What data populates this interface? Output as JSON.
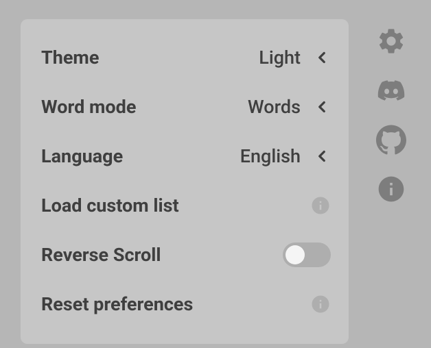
{
  "settings": {
    "theme": {
      "label": "Theme",
      "value": "Light"
    },
    "wordMode": {
      "label": "Word mode",
      "value": "Words"
    },
    "language": {
      "label": "Language",
      "value": "English"
    },
    "loadCustomList": {
      "label": "Load custom list"
    },
    "reverseScroll": {
      "label": "Reverse Scroll",
      "enabled": false
    },
    "resetPreferences": {
      "label": "Reset preferences"
    }
  }
}
